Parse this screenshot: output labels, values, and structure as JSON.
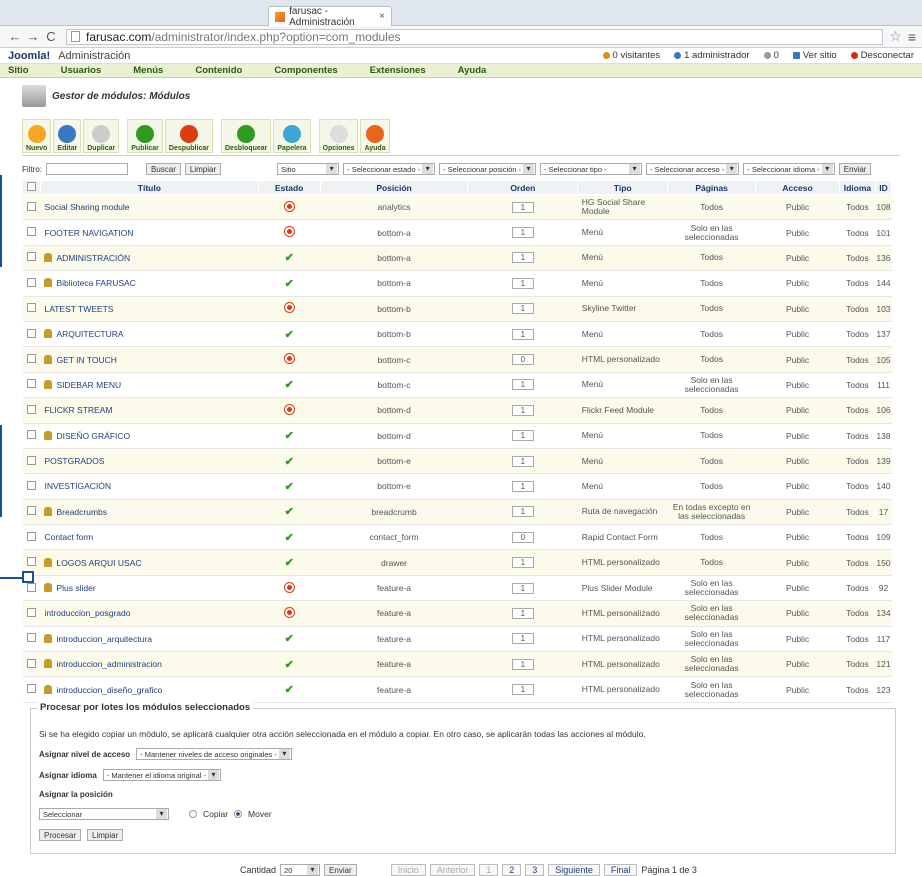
{
  "browser": {
    "tab_title": "farusac - Administración",
    "tab_close": "×",
    "url_host": "farusac.com",
    "url_path": "/administrator/index.php?option=com_modules"
  },
  "header": {
    "logo": "Joomla!",
    "title": "Administración",
    "status": [
      "0 visitantes",
      "1 administrador",
      "0",
      "Ver sitio",
      "Desconectar"
    ]
  },
  "menu": [
    "Sitio",
    "Usuarios",
    "Menús",
    "Contenido",
    "Componentes",
    "Extensiones",
    "Ayuda"
  ],
  "page_title": "Gestor de módulos: Módulos",
  "toolbar": [
    {
      "label": "Nuevo",
      "color": "#f5a623"
    },
    {
      "label": "Editar",
      "color": "#3a78c4"
    },
    {
      "label": "Duplicar",
      "color": "#cccccc"
    },
    {
      "label": "Publicar",
      "color": "#2f9b1e"
    },
    {
      "label": "Despublicar",
      "color": "#e03a10"
    },
    {
      "label": "Desbloquear",
      "color": "#2f9b1e"
    },
    {
      "label": "Papelera",
      "color": "#3aa7d6"
    },
    {
      "label": "Opciones",
      "color": "#dddddd"
    },
    {
      "label": "Ayuda",
      "color": "#e8651b"
    }
  ],
  "filter": {
    "label": "Filtro:",
    "buscar": "Buscar",
    "limpiar": "Limpiar",
    "sitio": "Sitio",
    "estado": "- Seleccionar estado -",
    "posicion": "- Seleccionar posición -",
    "tipo": "- Seleccionar tipo -",
    "acceso": "- Seleccionar acceso -",
    "idioma": "- Seleccionar idioma -",
    "enviar": "Enviar"
  },
  "columns": [
    "Título",
    "Estado",
    "Posición",
    "Orden",
    "Tipo",
    "Páginas",
    "Acceso",
    "Idioma",
    "ID"
  ],
  "rows": [
    [
      "Social Sharing module",
      0,
      0,
      "analytics",
      "1",
      "HG Social Share Module",
      "Todos",
      "Public",
      "Todos",
      "108"
    ],
    [
      "FOOTER NAVIGATION",
      0,
      0,
      "bottom-a",
      "1",
      "Menú",
      "Solo en las seleccionadas",
      "Public",
      "Todos",
      "101"
    ],
    [
      "ADMINISTRACIÓN",
      1,
      1,
      "bottom-a",
      "1",
      "Menú",
      "Todos",
      "Public",
      "Todos",
      "136"
    ],
    [
      "Biblioteca FARUSAC",
      1,
      1,
      "bottom-a",
      "1",
      "Menú",
      "Todos",
      "Public",
      "Todos",
      "144"
    ],
    [
      "LATEST TWEETS",
      0,
      0,
      "bottom-b",
      "1",
      "Skyline Twitter",
      "Todos",
      "Public",
      "Todos",
      "103"
    ],
    [
      "ARQUITECTURA",
      1,
      1,
      "bottom-b",
      "1",
      "Menú",
      "Todos",
      "Public",
      "Todos",
      "137"
    ],
    [
      "GET IN TOUCH",
      1,
      0,
      "bottom-c",
      "0",
      "HTML personalizado",
      "Todos",
      "Public",
      "Todos",
      "105"
    ],
    [
      "SIDEBAR MENU",
      1,
      1,
      "bottom-c",
      "1",
      "Menú",
      "Solo en las seleccionadas",
      "Public",
      "Todos",
      "111"
    ],
    [
      "FLICKR STREAM",
      0,
      0,
      "bottom-d",
      "1",
      "Flickr Feed Module",
      "Todos",
      "Public",
      "Todos",
      "106"
    ],
    [
      "DISEÑO GRÁFICO",
      1,
      1,
      "bottom-d",
      "1",
      "Menú",
      "Todos",
      "Public",
      "Todos",
      "138"
    ],
    [
      "POSTGRADOS",
      0,
      1,
      "bottom-e",
      "1",
      "Menú",
      "Todos",
      "Public",
      "Todos",
      "139"
    ],
    [
      "INVESTIGACIÓN",
      0,
      1,
      "bottom-e",
      "1",
      "Menú",
      "Todos",
      "Public",
      "Todos",
      "140"
    ],
    [
      "Breadcrumbs",
      1,
      1,
      "breadcrumb",
      "1",
      "Ruta de navegación",
      "En todas excepto en las seleccionadas",
      "Public",
      "Todos",
      "17"
    ],
    [
      "Contact form",
      0,
      1,
      "contact_form",
      "0",
      "Rapid Contact Form",
      "Todos",
      "Public",
      "Todos",
      "109"
    ],
    [
      "LOGOS ARQUI USAC",
      1,
      1,
      "drawer",
      "1",
      "HTML personalizado",
      "Todos",
      "Public",
      "Todos",
      "150"
    ],
    [
      "Plus slider",
      1,
      0,
      "feature-a",
      "1",
      "Plus Slider Module",
      "Solo en las seleccionadas",
      "Public",
      "Todos",
      "92"
    ],
    [
      "introduccion_posgrado",
      0,
      0,
      "feature-a",
      "1",
      "HTML personalizado",
      "Solo en las seleccionadas",
      "Public",
      "Todos",
      "134"
    ],
    [
      "introduccion_arquitectura",
      1,
      1,
      "feature-a",
      "1",
      "HTML personalizado",
      "Solo en las seleccionadas",
      "Public",
      "Todos",
      "117"
    ],
    [
      "introduccion_administracion",
      1,
      1,
      "feature-a",
      "1",
      "HTML personalizado",
      "Solo en las seleccionadas",
      "Public",
      "Todos",
      "121"
    ],
    [
      "introduccion_diseño_grafico",
      1,
      1,
      "feature-a",
      "1",
      "HTML personalizado",
      "Solo en las seleccionadas",
      "Public",
      "Todos",
      "123"
    ]
  ],
  "batch": {
    "legend": "Procesar por lotes los módulos seleccionados",
    "info": "Si se ha elegido copiar un módulo, se aplicará cualquier otra acción seleccionada en el módulo a copiar. En otro caso, se aplicarán todas las acciones al módulo.",
    "nivel_label": "Asignar nivel de acceso",
    "nivel_value": "- Mantener niveles de acceso originales -",
    "idioma_label": "Asignar idioma",
    "idioma_value": "- Mantener el idioma original -",
    "pos_label": "Asignar la posición",
    "pos_value": "Seleccionar",
    "copiar": "Copiar",
    "mover": "Mover",
    "procesar": "Procesar",
    "limpiar": "Limpiar"
  },
  "pager": {
    "cantidad": "Cantidad",
    "cantidad_value": "20",
    "enviar": "Enviar",
    "inicio": "Inicio",
    "anterior": "Anterior",
    "pages": [
      "1",
      "2",
      "3"
    ],
    "siguiente": "Siguiente",
    "final": "Final",
    "info": "Página 1 de 3"
  }
}
